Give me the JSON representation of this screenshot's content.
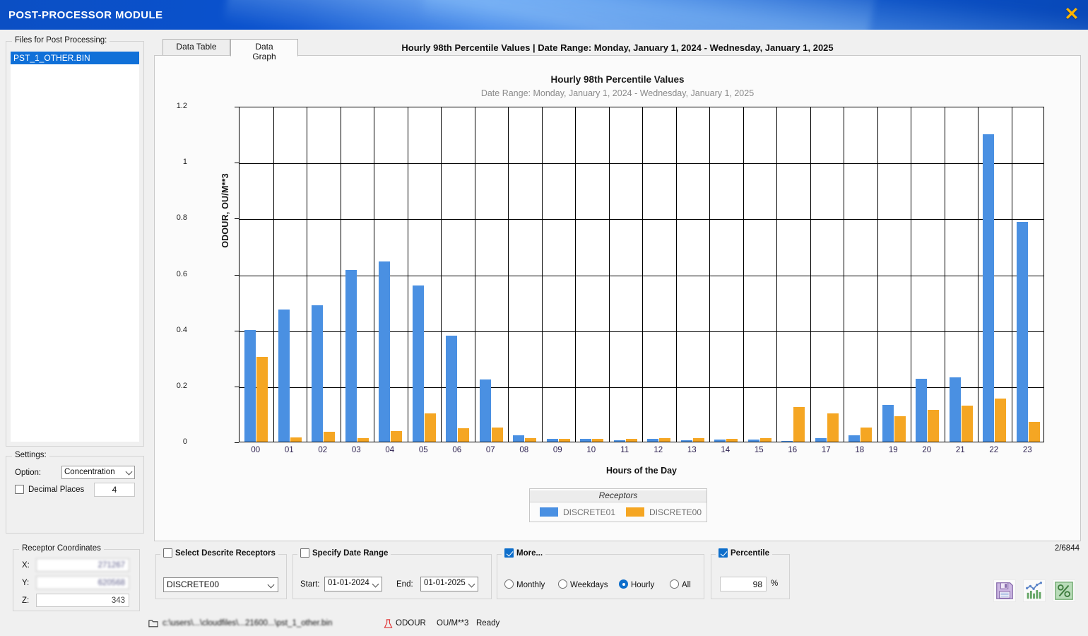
{
  "window": {
    "title": "POST-PROCESSOR MODULE",
    "close_icon": "close-icon"
  },
  "sidebar": {
    "files_group_title": "Files for Post Processing:",
    "files": [
      "PST_1_OTHER.BIN"
    ],
    "settings_group_title": "Settings:",
    "option_label": "Option:",
    "option_value": "Concentration",
    "decimal_places_label": "Decimal Places",
    "decimal_places_value": "4",
    "decimal_places_checked": false,
    "receptor_group_title": "Receptor Coordinates",
    "coords": [
      {
        "axis": "X:",
        "value": "271267",
        "blurred": true
      },
      {
        "axis": "Y:",
        "value": "620568",
        "blurred": true
      },
      {
        "axis": "Z:",
        "value": "343",
        "blurred": false
      }
    ]
  },
  "tabs": [
    {
      "label": "Data Table",
      "active": false
    },
    {
      "label": "Data Graph",
      "active": true
    }
  ],
  "panel_title": "Hourly 98th Percentile Values | Date Range: Monday, January 1, 2024 - Wednesday, January 1, 2025",
  "chart_data": {
    "type": "bar",
    "title": "Hourly 98th Percentile Values",
    "subtitle": "Date Range: Monday, January 1, 2024 - Wednesday, January 1, 2025",
    "xlabel": "Hours of the Day",
    "ylabel": "ODOUR, OU/M**3",
    "ylim": [
      0,
      1.2
    ],
    "yticks": [
      0,
      0.2,
      0.4,
      0.6,
      0.8,
      1,
      1.2
    ],
    "ytick_labels": [
      "0",
      "0.2",
      "0.4",
      "0.6",
      "0.8",
      "1",
      "1.2"
    ],
    "grid": true,
    "legend_title": "Receptors",
    "legend_position": "bottom",
    "categories": [
      "00",
      "01",
      "02",
      "03",
      "04",
      "05",
      "06",
      "07",
      "08",
      "09",
      "10",
      "11",
      "12",
      "13",
      "14",
      "15",
      "16",
      "17",
      "18",
      "19",
      "20",
      "21",
      "22",
      "23"
    ],
    "series": [
      {
        "name": "DISCRETE01",
        "color": "#4a90e2",
        "values": [
          0.4,
          0.473,
          0.488,
          0.613,
          0.645,
          0.559,
          0.378,
          0.223,
          0.024,
          0.01,
          0.01,
          0.006,
          0.009,
          0.005,
          0.008,
          0.007,
          0.002,
          0.013,
          0.022,
          0.131,
          0.226,
          0.229,
          1.1,
          0.785
        ]
      },
      {
        "name": "DISCRETE00",
        "color": "#f5a623",
        "values": [
          0.304,
          0.016,
          0.035,
          0.012,
          0.038,
          0.1,
          0.047,
          0.05,
          0.013,
          0.011,
          0.011,
          0.011,
          0.013,
          0.012,
          0.011,
          0.013,
          0.123,
          0.102,
          0.051,
          0.09,
          0.114,
          0.128,
          0.154,
          0.072
        ]
      }
    ]
  },
  "controls": {
    "select_receptors": {
      "label": "Select Descrite Receptors",
      "checked": false,
      "value": "DISCRETE00"
    },
    "date_range": {
      "label": "Specify Date Range",
      "checked": false,
      "start_label": "Start:",
      "start_value": "01-01-2024",
      "end_label": "End:",
      "end_value": "01-01-2025"
    },
    "more": {
      "label": "More...",
      "checked": true,
      "options": [
        {
          "label": "Monthly",
          "selected": false
        },
        {
          "label": "Weekdays",
          "selected": false
        },
        {
          "label": "Hourly",
          "selected": true
        },
        {
          "label": "All",
          "selected": false
        }
      ]
    },
    "percentile": {
      "label": "Percentile",
      "checked": true,
      "value": "98",
      "unit": "%"
    },
    "counter": "2/6844",
    "icons": [
      {
        "name": "save-icon"
      },
      {
        "name": "chart-icon"
      },
      {
        "name": "percent-icon"
      }
    ]
  },
  "statusbar": {
    "folder_icon": "folder-icon",
    "path": "c:\\users\\...\\cloudfiles\\...21600...\\pst_1_other.bin",
    "flask_icon": "flask-icon",
    "pollutant": "ODOUR",
    "units": "OU/M**3",
    "state": "Ready"
  }
}
